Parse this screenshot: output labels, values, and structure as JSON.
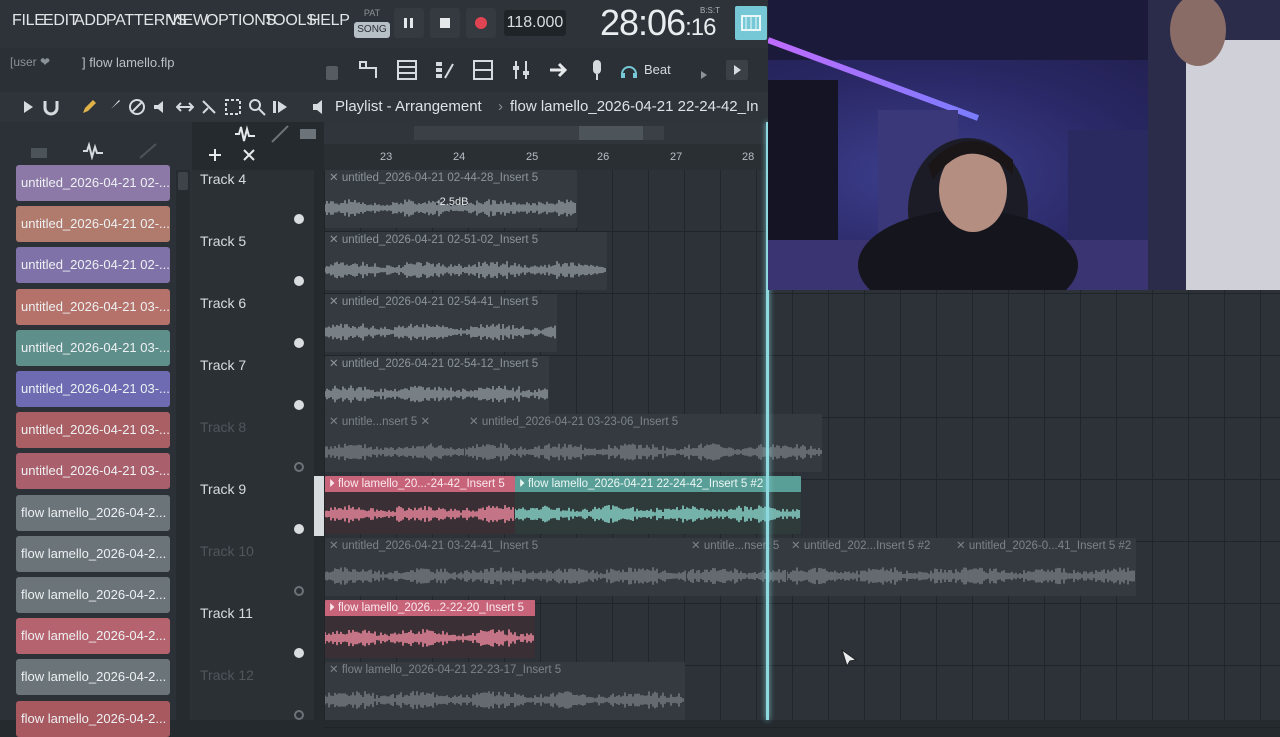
{
  "menu": {
    "file": "FILE",
    "edit": "EDIT",
    "add": "ADD",
    "patterns": "PATTERNS",
    "view": "VIEW",
    "options": "OPTIONS",
    "tools": "TOOLS",
    "help": "HELP"
  },
  "transport": {
    "pat_label": "PAT",
    "song_label": "SONG",
    "tempo": "118.000",
    "time_main": "28:06",
    "time_ticks": "16",
    "time_format": "B:S:T"
  },
  "hint": {
    "user": "[user ❤",
    "file": "] flow lamello.flp"
  },
  "toolbar2": {
    "beat_label": "Beat"
  },
  "playlist": {
    "title": "Playlist - Arrangement",
    "file": "flow lamello_2026-04-21 22-24-42_In"
  },
  "ruler": {
    "bars": [
      "23",
      "24",
      "25",
      "26",
      "27",
      "28"
    ]
  },
  "picker": {
    "items": [
      {
        "label": "untitled_2026-04-21 02-...",
        "color": "#8d79a8"
      },
      {
        "label": "untitled_2026-04-21 02-...",
        "color": "#b07a6c"
      },
      {
        "label": "untitled_2026-04-21 02-...",
        "color": "#7f72a8"
      },
      {
        "label": "untitled_2026-04-21 03-...",
        "color": "#b5726a"
      },
      {
        "label": "untitled_2026-04-21 03-...",
        "color": "#5f8f8b"
      },
      {
        "label": "untitled_2026-04-21 03-...",
        "color": "#6e6bb2"
      },
      {
        "label": "untitled_2026-04-21 03-...",
        "color": "#aa5f64"
      },
      {
        "label": "untitled_2026-04-21 03-...",
        "color": "#a95f6c"
      },
      {
        "label": "flow lamello_2026-04-2...",
        "color": "#6a7479"
      },
      {
        "label": "flow lamello_2026-04-2...",
        "color": "#6a7479"
      },
      {
        "label": "flow lamello_2026-04-2...",
        "color": "#6a7479"
      },
      {
        "label": "flow lamello_2026-04-2...",
        "color": "#b5646f"
      },
      {
        "label": "flow lamello_2026-04-2...",
        "color": "#6a7479"
      },
      {
        "label": "flow lamello_2026-04-2...",
        "color": "#a8585f"
      }
    ]
  },
  "tracks": [
    {
      "name": "Track 4",
      "dim": false
    },
    {
      "name": "Track 5",
      "dim": false
    },
    {
      "name": "Track 6",
      "dim": false
    },
    {
      "name": "Track 7",
      "dim": false
    },
    {
      "name": "Track 8",
      "dim": true
    },
    {
      "name": "Track 9",
      "dim": false
    },
    {
      "name": "Track 10",
      "dim": true
    },
    {
      "name": "Track 11",
      "dim": false
    },
    {
      "name": "Track 12",
      "dim": true
    }
  ],
  "clips": {
    "t4": "untitled_2026-04-21 02-44-28_Insert 5",
    "t4_gain": "-2.5dB",
    "t5": "untitled_2026-04-21 02-51-02_Insert 5",
    "t6": "untitled_2026-04-21 02-54-41_Insert 5",
    "t7": "untitled_2026-04-21 02-54-12_Insert 5",
    "t8a": "untitle...nsert 5",
    "t8b": "untitled_2026-04-21 03-23-06_Insert 5",
    "t9a": "flow lamello_20...-24-42_Insert 5",
    "t9b": "flow lamello_2026-04-21 22-24-42_Insert 5 #2",
    "t10a": "untitled_2026-04-21 03-24-41_Insert 5",
    "t10b": "untitle...nsert 5",
    "t10c": "untitled_202...Insert 5 #2",
    "t10d": "untitled_2026-0...41_Insert 5 #2",
    "t11": "flow lamello_2026...2-22-20_Insert 5",
    "t12": "flow lamello_2026-04-21 22-23-17_Insert 5"
  },
  "colors": {
    "accent": "#77c8d6",
    "playhead": "#8ed8e0",
    "pink_clip": "#c8647a",
    "teal_clip": "#5a9f97",
    "record": "#e04453"
  }
}
